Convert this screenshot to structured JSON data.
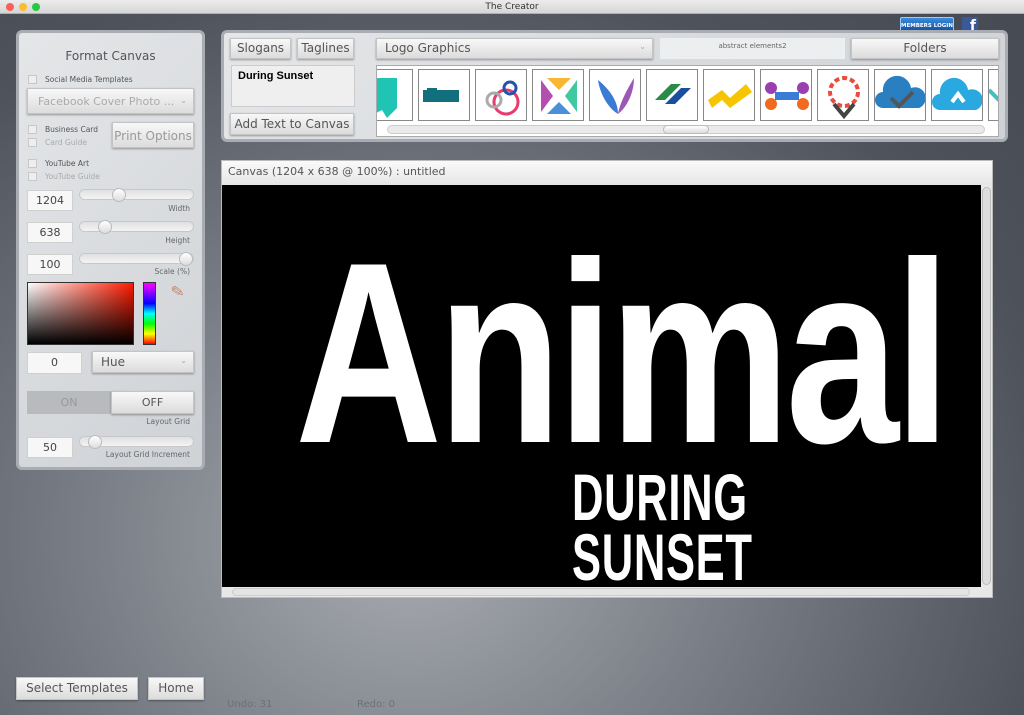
{
  "window": {
    "title": "The Creator"
  },
  "format_canvas": {
    "title": "Format Canvas",
    "social_media_templates": "Social Media Templates",
    "template_select": "Facebook Cover Photo ...",
    "business_card": "Business Card",
    "card_guide": "Card Guide",
    "print_options": "Print Options",
    "youtube_art": "YouTube Art",
    "youtube_guide": "YouTube Guide",
    "width_value": "1204",
    "width_label": "Width",
    "width_fraction": 0.32,
    "height_value": "638",
    "height_label": "Height",
    "height_fraction": 0.18,
    "scale_value": "100",
    "scale_label": "Scale (%)",
    "scale_fraction": 1.0,
    "hue_value": "0",
    "color_mode": "Hue",
    "base_color": "#ff1a00",
    "grid_on": "ON",
    "grid_off": "OFF",
    "grid_label": "Layout Grid",
    "grid_state": "off",
    "increment_value": "50",
    "increment_label": "Layout Grid Increment",
    "increment_fraction": 0.08
  },
  "top_panel": {
    "slogans": "Slogans",
    "taglines": "Taglines",
    "text_preview": "During Sunset",
    "add_text": "Add Text to Canvas",
    "category_select": "Logo Graphics",
    "collection_name": "abstract elements2",
    "folders": "Folders",
    "members_login": "MEMBERS LOGIN",
    "facebook": "f",
    "thumbnails": [
      "teal-ribbon",
      "banner-ribbon",
      "rings",
      "x-arrows",
      "feather-v",
      "arrows-logo",
      "yellow-zigzag",
      "molecule-dots",
      "pin-dots",
      "cloud-check",
      "cloud-sync",
      "partial"
    ],
    "scroll_fraction": 0.5
  },
  "canvas": {
    "header": "Canvas (1204 x 638 @ 100%) : untitled",
    "main_text": "Animal",
    "sub_text": "DURING SUNSET",
    "background": "#000000",
    "text_color": "#ffffff"
  },
  "footer": {
    "select_templates": "Select Templates",
    "home": "Home",
    "undo": "Undo: 31",
    "redo": "Redo: 0"
  }
}
